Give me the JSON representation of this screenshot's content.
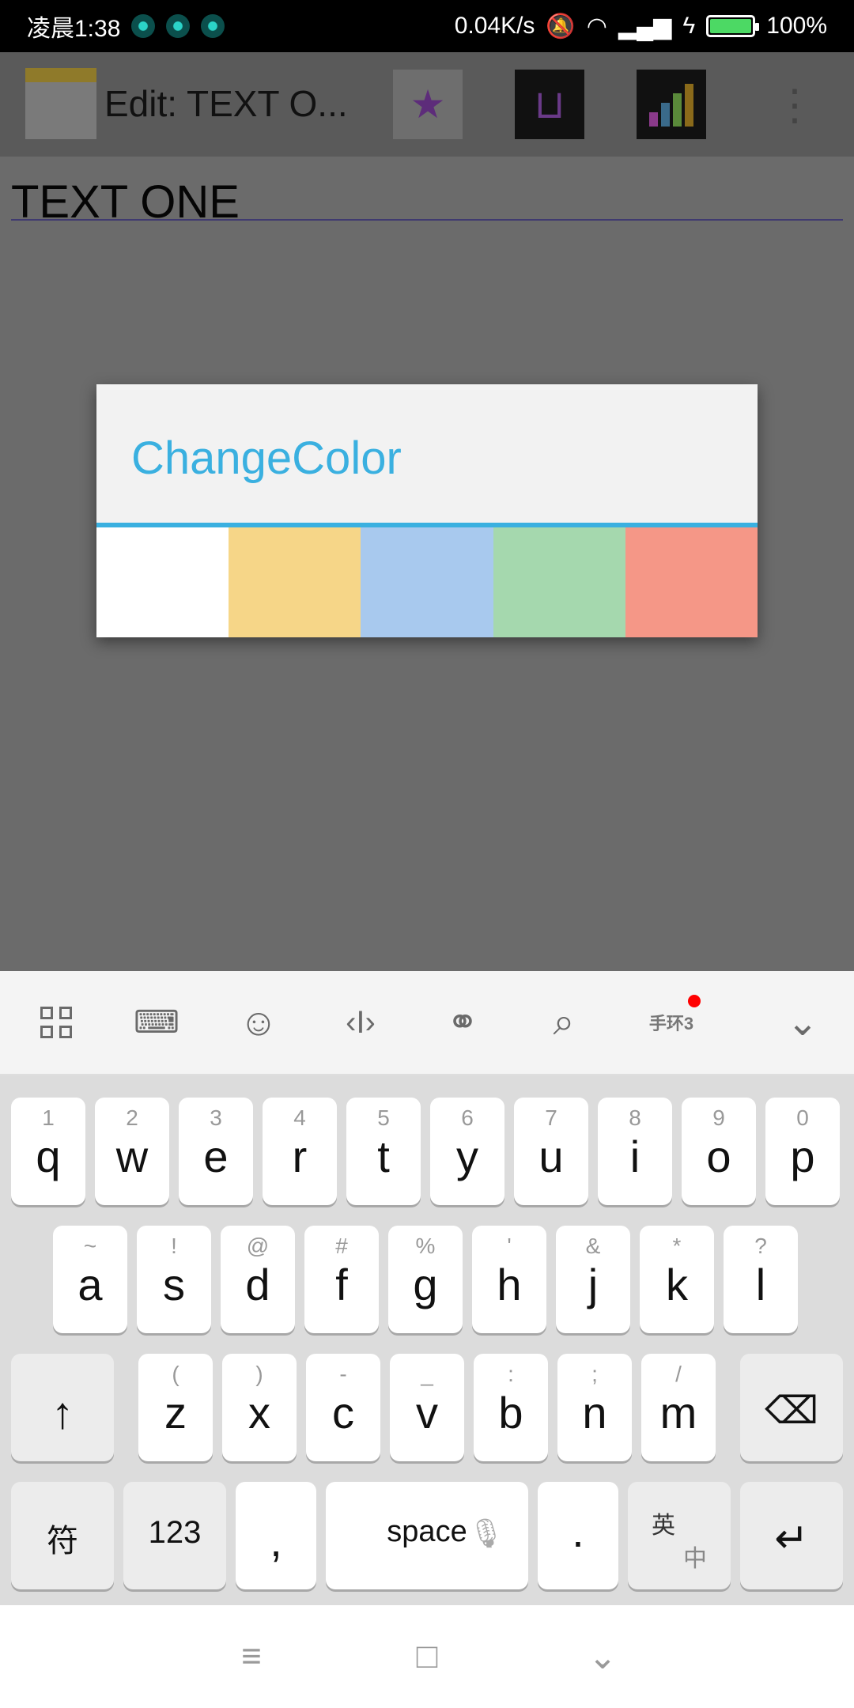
{
  "status_bar": {
    "time": "凌晨1:38",
    "net_speed": "0.04K/s",
    "battery_pct": "100%",
    "battery_level": 1.0
  },
  "toolbar": {
    "title": "Edit: TEXT O...",
    "icons": [
      "note-icon",
      "bookmark-star-icon",
      "basket-icon",
      "bar-chart-icon",
      "overflow-menu-icon"
    ]
  },
  "editor": {
    "title_value": "TEXT ONE"
  },
  "dialog": {
    "title": "ChangeColor",
    "accent": "#3ab0e0",
    "swatches": [
      {
        "name": "white",
        "color": "#ffffff"
      },
      {
        "name": "yellow",
        "color": "#f6d688"
      },
      {
        "name": "blue",
        "color": "#a8c9ee"
      },
      {
        "name": "green",
        "color": "#a5d8ae"
      },
      {
        "name": "salmon",
        "color": "#f59787"
      }
    ]
  },
  "keyboard_toolbar": {
    "band_label": "手环3",
    "icons": [
      "apps-grid-icon",
      "keyboard-icon",
      "emoji-icon",
      "cursor-icon",
      "link-icon",
      "search-icon",
      "band-icon",
      "collapse-icon"
    ]
  },
  "keyboard": {
    "row1": [
      {
        "sub": "1",
        "key": "q"
      },
      {
        "sub": "2",
        "key": "w"
      },
      {
        "sub": "3",
        "key": "e"
      },
      {
        "sub": "4",
        "key": "r"
      },
      {
        "sub": "5",
        "key": "t"
      },
      {
        "sub": "6",
        "key": "y"
      },
      {
        "sub": "7",
        "key": "u"
      },
      {
        "sub": "8",
        "key": "i"
      },
      {
        "sub": "9",
        "key": "o"
      },
      {
        "sub": "0",
        "key": "p"
      }
    ],
    "row2": [
      {
        "sub": "~",
        "key": "a"
      },
      {
        "sub": "!",
        "key": "s"
      },
      {
        "sub": "@",
        "key": "d"
      },
      {
        "sub": "#",
        "key": "f"
      },
      {
        "sub": "%",
        "key": "g"
      },
      {
        "sub": "'",
        "key": "h"
      },
      {
        "sub": "&",
        "key": "j"
      },
      {
        "sub": "*",
        "key": "k"
      },
      {
        "sub": "?",
        "key": "l"
      }
    ],
    "row3": [
      {
        "sub": "(",
        "key": "z"
      },
      {
        "sub": ")",
        "key": "x"
      },
      {
        "sub": "-",
        "key": "c"
      },
      {
        "sub": "_",
        "key": "v"
      },
      {
        "sub": ":",
        "key": "b"
      },
      {
        "sub": ";",
        "key": "n"
      },
      {
        "sub": "/",
        "key": "m"
      }
    ],
    "shift": "↑",
    "backspace": "⌫",
    "symbols": "符",
    "numbers": "123",
    "comma": ",",
    "space": "space",
    "period": "·",
    "lang_top": "英",
    "lang_bottom": "中",
    "enter": "↵"
  }
}
